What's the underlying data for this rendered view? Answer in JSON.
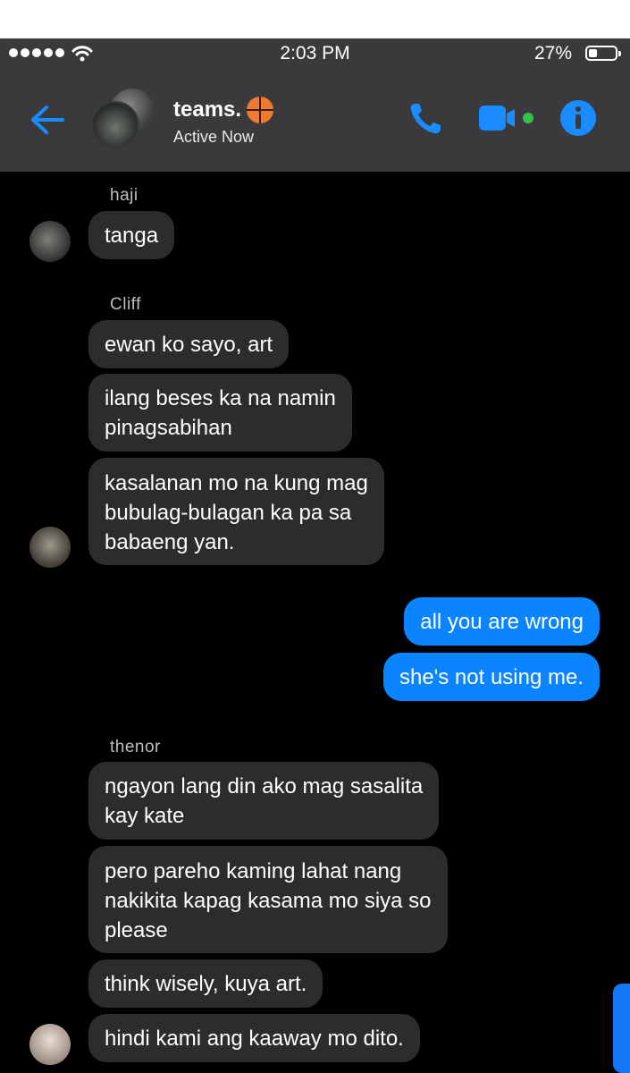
{
  "status_bar": {
    "time": "2:03 PM",
    "battery": "27%"
  },
  "header": {
    "title": "teams.",
    "title_emoji_icon": "basketball-icon",
    "subtitle": "Active Now",
    "icons": [
      "back-arrow-icon",
      "phone-icon",
      "video-icon",
      "info-icon"
    ],
    "accent_color": "#0a84ff"
  },
  "messages": {
    "haji": {
      "sender": "haji",
      "texts": [
        "tanga"
      ]
    },
    "cliff": {
      "sender": "Cliff",
      "texts": [
        "ewan ko sayo, art",
        "ilang beses ka na namin\npinagsabihan",
        "kasalanan mo na kung mag\nbubulag-bulagan ka pa sa\nbabaeng yan."
      ]
    },
    "me": {
      "texts": [
        "all you are wrong",
        "she's not using me."
      ]
    },
    "thenor": {
      "sender": "thenor",
      "texts": [
        "ngayon lang din ako mag sasalita\nkay kate",
        "pero pareho kaming lahat nang\nnakikita kapag kasama mo siya so\nplease",
        "think wisely, kuya art.",
        "hindi kami ang kaaway mo dito."
      ]
    }
  }
}
